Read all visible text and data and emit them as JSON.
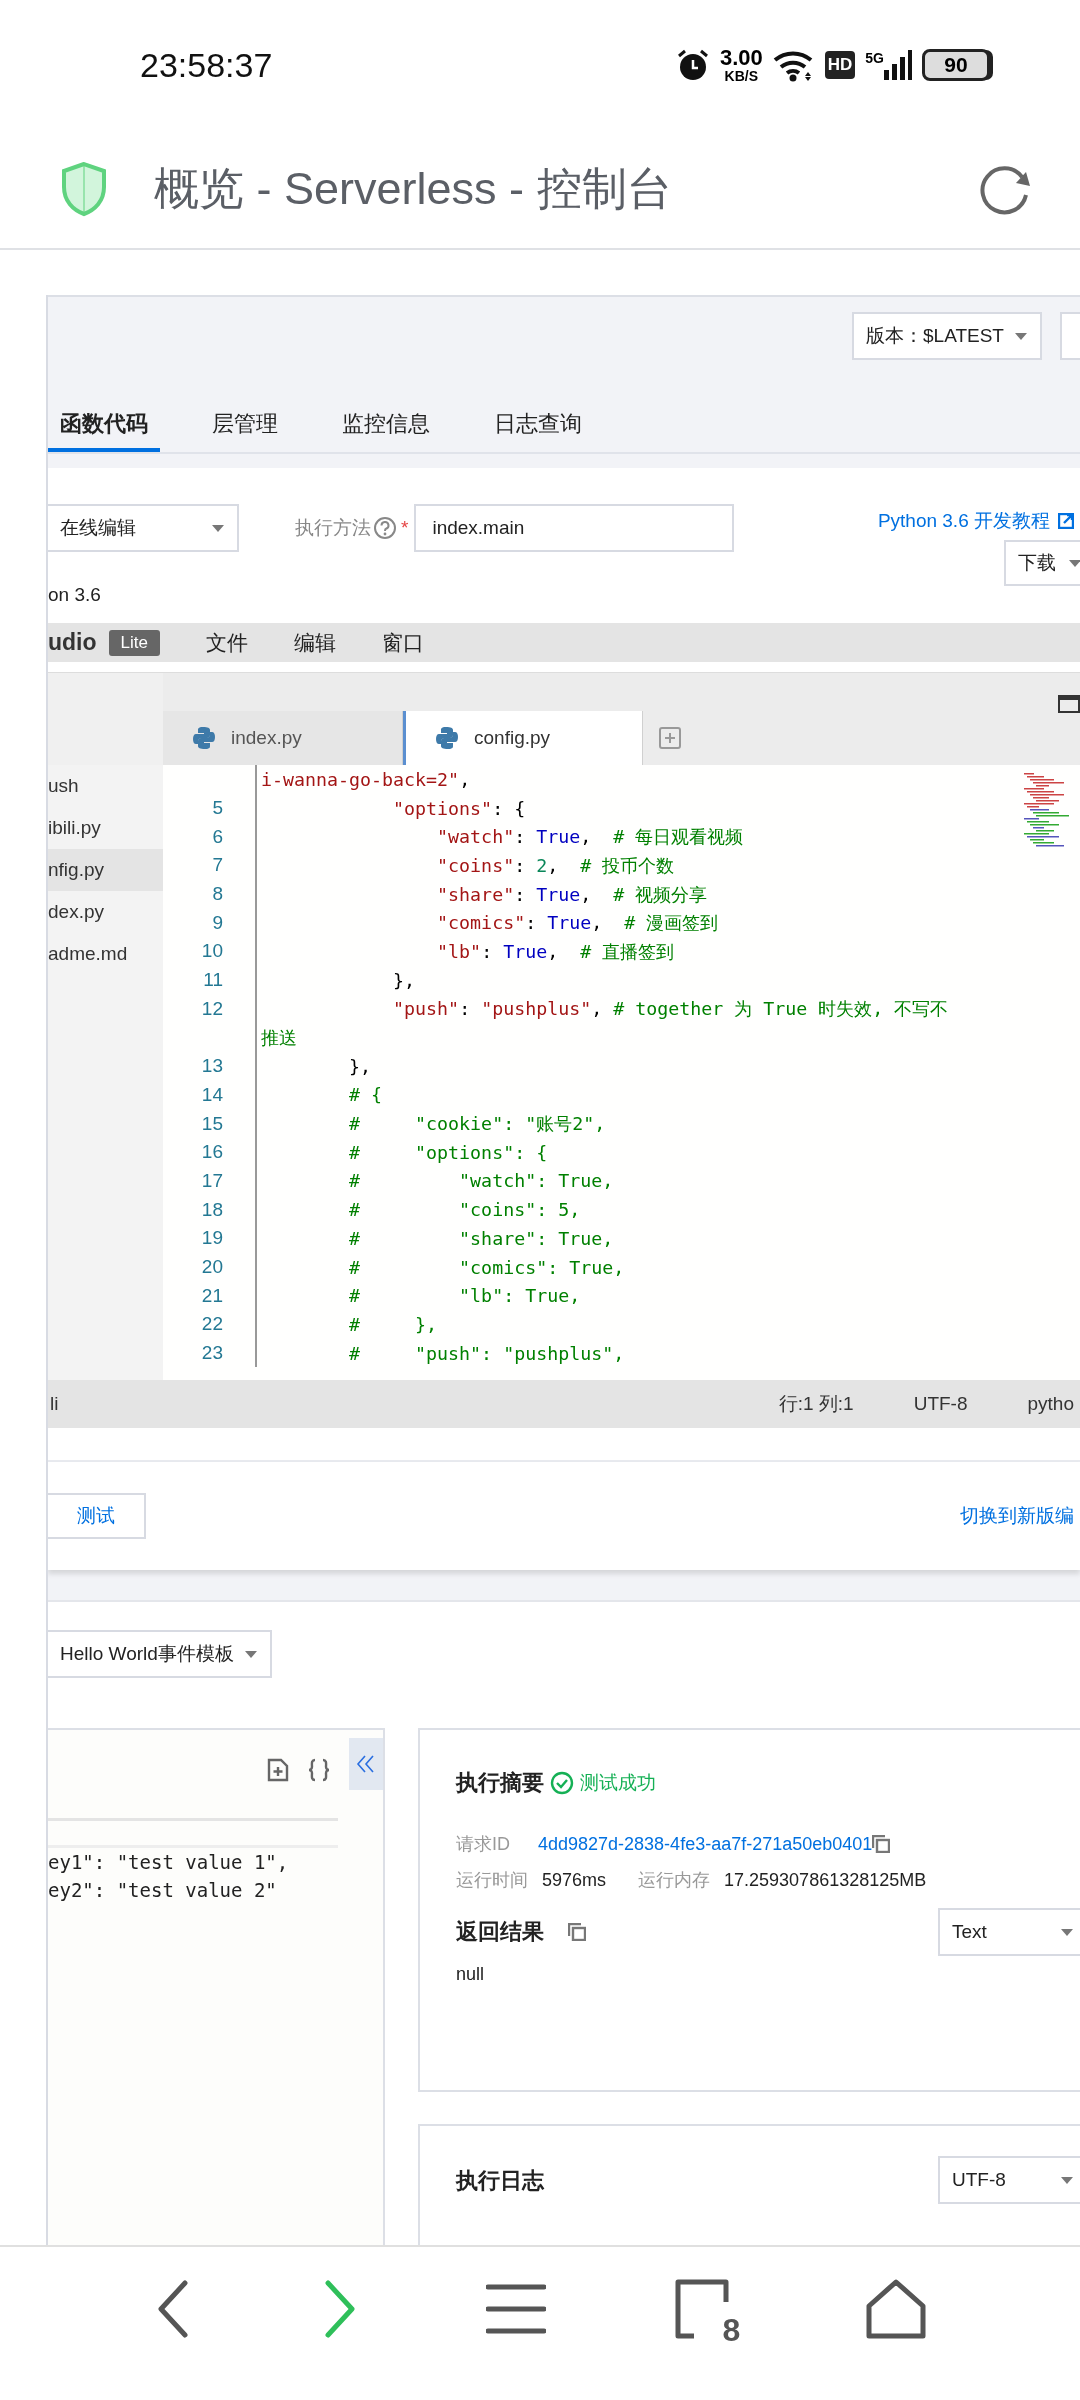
{
  "status_bar": {
    "time": "23:58:37",
    "speed": "3.00",
    "speed_unit": "KB/S",
    "hd": "HD",
    "network": "5G",
    "battery": "90"
  },
  "browser": {
    "title": "概览 - Serverless - 控制台"
  },
  "version_select": {
    "value": "版本：$LATEST"
  },
  "tabs": [
    {
      "label": "函数代码",
      "selected": true
    },
    {
      "label": "层管理",
      "selected": false
    },
    {
      "label": "监控信息",
      "selected": false
    },
    {
      "label": "日志查询",
      "selected": false
    }
  ],
  "edit_mode_select": {
    "value": "在线编辑"
  },
  "handler": {
    "label": "执行方法",
    "required": "*",
    "value": "index.main"
  },
  "tutorial_link": "Python 3.6 开发教程",
  "download_button": "下载",
  "runtime_text": "on 3.6",
  "ide": {
    "brand": "udio",
    "badge": "Lite",
    "menu": [
      "文件",
      "编辑",
      "窗口"
    ],
    "files": [
      {
        "name": "ush",
        "selected": false
      },
      {
        "name": "ibili.py",
        "selected": false
      },
      {
        "name": "nfig.py",
        "selected": true
      },
      {
        "name": "dex.py",
        "selected": false
      },
      {
        "name": "adme.md",
        "selected": false
      }
    ],
    "editor_tabs": [
      {
        "name": "index.py",
        "selected": false
      },
      {
        "name": "config.py",
        "selected": true
      }
    ],
    "code_lines": [
      {
        "tokens": [
          {
            "kind": "string",
            "text": "i-wanna-go-back=2\""
          },
          {
            "kind": "plain",
            "text": ","
          }
        ]
      },
      {
        "number": "5",
        "tokens": [
          {
            "kind": "string",
            "text": "            \"options\""
          },
          {
            "kind": "plain",
            "text": ": {"
          }
        ]
      },
      {
        "number": "6",
        "tokens": [
          {
            "kind": "string",
            "text": "                \"watch\""
          },
          {
            "kind": "plain",
            "text": ": "
          },
          {
            "kind": "keyword",
            "text": "True"
          },
          {
            "kind": "plain",
            "text": ",  "
          },
          {
            "kind": "comment",
            "text": "# 每日观看视频"
          }
        ]
      },
      {
        "number": "7",
        "tokens": [
          {
            "kind": "string",
            "text": "                \"coins\""
          },
          {
            "kind": "plain",
            "text": ": "
          },
          {
            "kind": "number",
            "text": "2"
          },
          {
            "kind": "plain",
            "text": ",  "
          },
          {
            "kind": "comment",
            "text": "# 投币个数"
          }
        ]
      },
      {
        "number": "8",
        "tokens": [
          {
            "kind": "string",
            "text": "                \"share\""
          },
          {
            "kind": "plain",
            "text": ": "
          },
          {
            "kind": "keyword",
            "text": "True"
          },
          {
            "kind": "plain",
            "text": ",  "
          },
          {
            "kind": "comment",
            "text": "# 视频分享"
          }
        ]
      },
      {
        "number": "9",
        "tokens": [
          {
            "kind": "string",
            "text": "                \"comics\""
          },
          {
            "kind": "plain",
            "text": ": "
          },
          {
            "kind": "keyword",
            "text": "True"
          },
          {
            "kind": "plain",
            "text": ",  "
          },
          {
            "kind": "comment",
            "text": "# 漫画签到"
          }
        ]
      },
      {
        "number": "10",
        "tokens": [
          {
            "kind": "string",
            "text": "                \"lb\""
          },
          {
            "kind": "plain",
            "text": ": "
          },
          {
            "kind": "keyword",
            "text": "True"
          },
          {
            "kind": "plain",
            "text": ",  "
          },
          {
            "kind": "comment",
            "text": "# 直播签到"
          }
        ]
      },
      {
        "number": "11",
        "tokens": [
          {
            "kind": "plain",
            "text": "            },"
          }
        ]
      },
      {
        "number": "12",
        "tokens": [
          {
            "kind": "string",
            "text": "            \"push\""
          },
          {
            "kind": "plain",
            "text": ": "
          },
          {
            "kind": "string",
            "text": "\"pushplus\""
          },
          {
            "kind": "plain",
            "text": ", "
          },
          {
            "kind": "comment",
            "text": "# together 为 True 时失效, 不写不"
          }
        ]
      },
      {
        "tokens": [
          {
            "kind": "comment",
            "text": "推送"
          }
        ]
      },
      {
        "number": "13",
        "tokens": [
          {
            "kind": "plain",
            "text": "        },"
          }
        ]
      },
      {
        "number": "14",
        "tokens": [
          {
            "kind": "comment",
            "text": "        # {"
          }
        ]
      },
      {
        "number": "15",
        "tokens": [
          {
            "kind": "comment",
            "text": "        #     \"cookie\": \"账号2\","
          }
        ]
      },
      {
        "number": "16",
        "tokens": [
          {
            "kind": "comment",
            "text": "        #     \"options\": {"
          }
        ]
      },
      {
        "number": "17",
        "tokens": [
          {
            "kind": "comment",
            "text": "        #         \"watch\": True,"
          }
        ]
      },
      {
        "number": "18",
        "tokens": [
          {
            "kind": "comment",
            "text": "        #         \"coins\": 5,"
          }
        ]
      },
      {
        "number": "19",
        "tokens": [
          {
            "kind": "comment",
            "text": "        #         \"share\": True,"
          }
        ]
      },
      {
        "number": "20",
        "tokens": [
          {
            "kind": "comment",
            "text": "        #         \"comics\": True,"
          }
        ]
      },
      {
        "number": "21",
        "tokens": [
          {
            "kind": "comment",
            "text": "        #         \"lb\": True,"
          }
        ]
      },
      {
        "number": "22",
        "tokens": [
          {
            "kind": "comment",
            "text": "        #     },"
          }
        ]
      },
      {
        "number": "23",
        "tokens": [
          {
            "kind": "comment",
            "text": "        #     \"push\": \"pushplus\","
          }
        ]
      }
    ],
    "status": {
      "left": "li",
      "position": "行:1 列:1",
      "encoding": "UTF-8",
      "language": "pytho"
    }
  },
  "test_button": "测试",
  "switch_link": "切换到新版编",
  "event_select": {
    "value": "Hello World事件模板"
  },
  "event_code": [
    "ey1\": \"test value 1\",",
    "ey2\": \"test value 2\""
  ],
  "summary": {
    "title": "执行摘要",
    "status": "测试成功",
    "request_id_label": "请求ID",
    "request_id": "4dd9827d-2838-4fe3-aa7f-271a50eb0401",
    "duration_label": "运行时间",
    "duration": "5976ms",
    "memory_label": "运行内存",
    "memory": "17.259307861328125MB",
    "result_title": "返回结果",
    "result_format": "Text",
    "result": "null"
  },
  "log": {
    "title": "执行日志",
    "encoding": "UTF-8"
  },
  "nav": {
    "tab_count": "8"
  }
}
